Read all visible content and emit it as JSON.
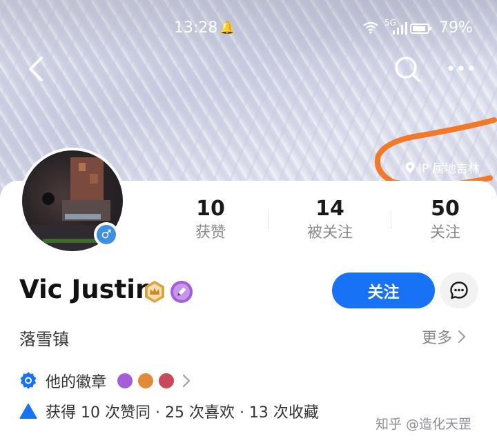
{
  "status_bar": {
    "time": "13:28",
    "battery_percent": "79%",
    "battery_level": 0.79,
    "network": "5G"
  },
  "header": {
    "ip_location": "IP 属地吉林",
    "annotation_color": "#f07a2a"
  },
  "profile": {
    "name": "Vic Justin",
    "gender_symbol": "♂",
    "location": "落雪镇",
    "more_label": "更多",
    "follow_label": "关注"
  },
  "stats": [
    {
      "value": "10",
      "label": "获赞"
    },
    {
      "value": "14",
      "label": "被关注"
    },
    {
      "value": "50",
      "label": "关注"
    }
  ],
  "badges": {
    "label": "他的徽章"
  },
  "achievements": {
    "text": "获得 10 次赞同 · 25 次喜欢 · 13 次收藏"
  },
  "watermark": "知乎 @造化天罡",
  "colors": {
    "accent": "#1772f6",
    "gold_badge": "#d9a441",
    "purple_badge": "#a45ed6",
    "annotation": "#f07a2a"
  },
  "icons": [
    "back-arrow-icon",
    "search-icon",
    "more-dots-icon",
    "location-pin-icon",
    "gender-male-icon",
    "creator-crown-icon",
    "pen-icon",
    "message-icon",
    "chevron-right-icon",
    "medal-icon",
    "triangle-icon"
  ]
}
